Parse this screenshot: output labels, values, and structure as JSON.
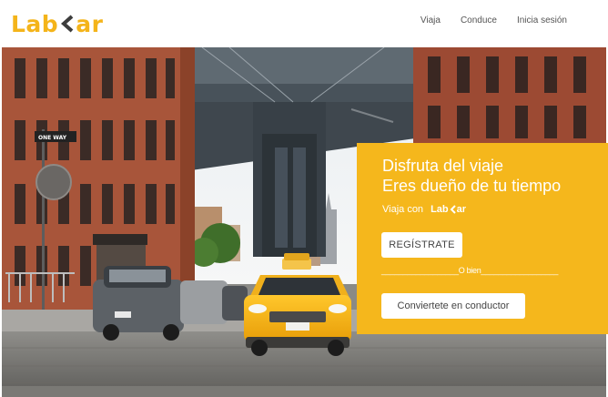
{
  "brand": {
    "left": "Lab",
    "right": "ar",
    "accent": "#f4b41a"
  },
  "nav": {
    "items": [
      "Viaja",
      "Conduce",
      "Inicia sesión"
    ]
  },
  "hero": {
    "street_sign": "ONE WAY",
    "headline_line1": "Disfruta del viaje",
    "headline_line2": "Eres dueño de tu tiempo",
    "ride_with": "Viaja con",
    "register_button": "REGÍSTRATE",
    "divider": "__________________O bien__________________",
    "driver_button": "Conviertete en conductor",
    "panel_color": "#f5b71c"
  }
}
